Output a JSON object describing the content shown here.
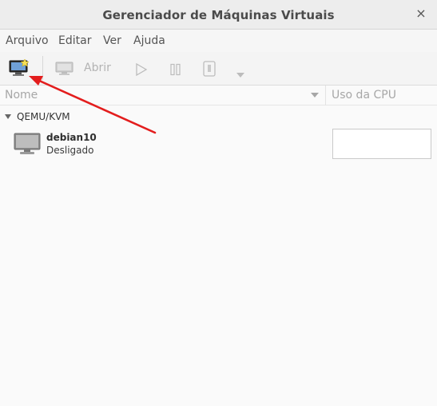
{
  "window": {
    "title": "Gerenciador de Máquinas Virtuais",
    "close_icon": "×"
  },
  "menu": {
    "items": [
      {
        "label": "Arquivo"
      },
      {
        "label": "Editar"
      },
      {
        "label": "Ver"
      },
      {
        "label": "Ajuda"
      }
    ]
  },
  "toolbar": {
    "new_vm_icon": "new-vm-icon",
    "open_label": "Abrir",
    "open_icon": "monitor-icon",
    "run_icon": "play-icon",
    "pause_icon": "pause-icon",
    "shutdown_icon": "power-icon",
    "menu_icon": "chevron-down-icon"
  },
  "columns": {
    "name": "Nome",
    "cpu": "Uso da CPU"
  },
  "connections": [
    {
      "label": "QEMU/KVM",
      "vms": [
        {
          "name": "debian10",
          "status": "Desligado",
          "icon": "monitor-icon"
        }
      ]
    }
  ],
  "annotation": {
    "arrow_color": "#e31d1d"
  }
}
